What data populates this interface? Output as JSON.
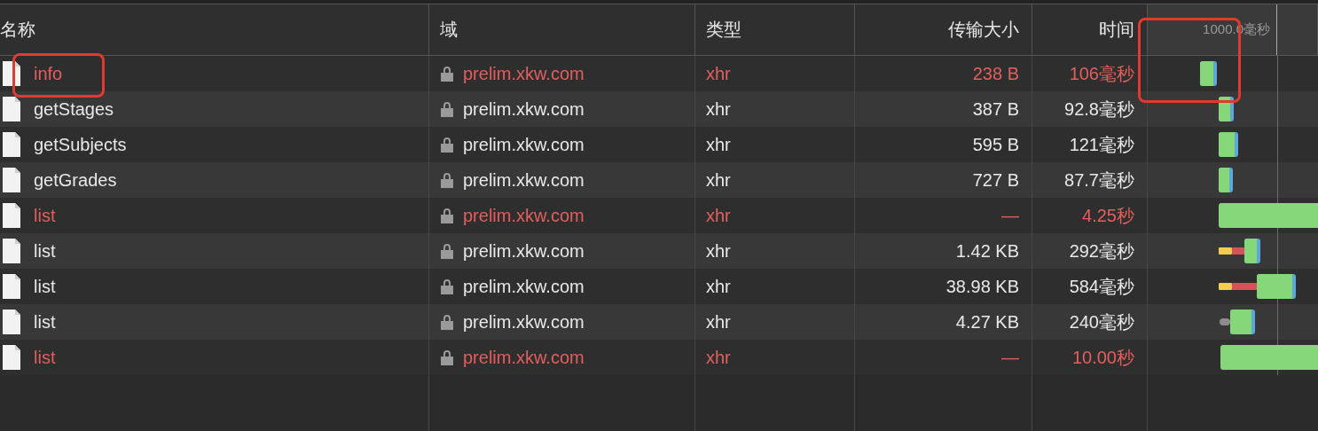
{
  "table": {
    "columns": [
      "名称",
      "域",
      "类型",
      "传输大小",
      "时间"
    ],
    "waterfall_header": "1000.0毫秒",
    "rows": [
      {
        "name": "info",
        "domain": "prelim.xkw.com",
        "type": "xhr",
        "size": "238 B",
        "time": "106毫秒",
        "error": true
      },
      {
        "name": "getStages",
        "domain": "prelim.xkw.com",
        "type": "xhr",
        "size": "387 B",
        "time": "92.8毫秒",
        "error": false
      },
      {
        "name": "getSubjects",
        "domain": "prelim.xkw.com",
        "type": "xhr",
        "size": "595 B",
        "time": "121毫秒",
        "error": false
      },
      {
        "name": "getGrades",
        "domain": "prelim.xkw.com",
        "type": "xhr",
        "size": "727 B",
        "time": "87.7毫秒",
        "error": false
      },
      {
        "name": "list",
        "domain": "prelim.xkw.com",
        "type": "xhr",
        "size": "—",
        "time": "4.25秒",
        "error": true
      },
      {
        "name": "list",
        "domain": "prelim.xkw.com",
        "type": "xhr",
        "size": "1.42 KB",
        "time": "292毫秒",
        "error": false
      },
      {
        "name": "list",
        "domain": "prelim.xkw.com",
        "type": "xhr",
        "size": "38.98 KB",
        "time": "584毫秒",
        "error": false
      },
      {
        "name": "list",
        "domain": "prelim.xkw.com",
        "type": "xhr",
        "size": "4.27 KB",
        "time": "240毫秒",
        "error": false
      },
      {
        "name": "list",
        "domain": "prelim.xkw.com",
        "type": "xhr",
        "size": "—",
        "time": "10.00秒",
        "error": true
      }
    ]
  }
}
